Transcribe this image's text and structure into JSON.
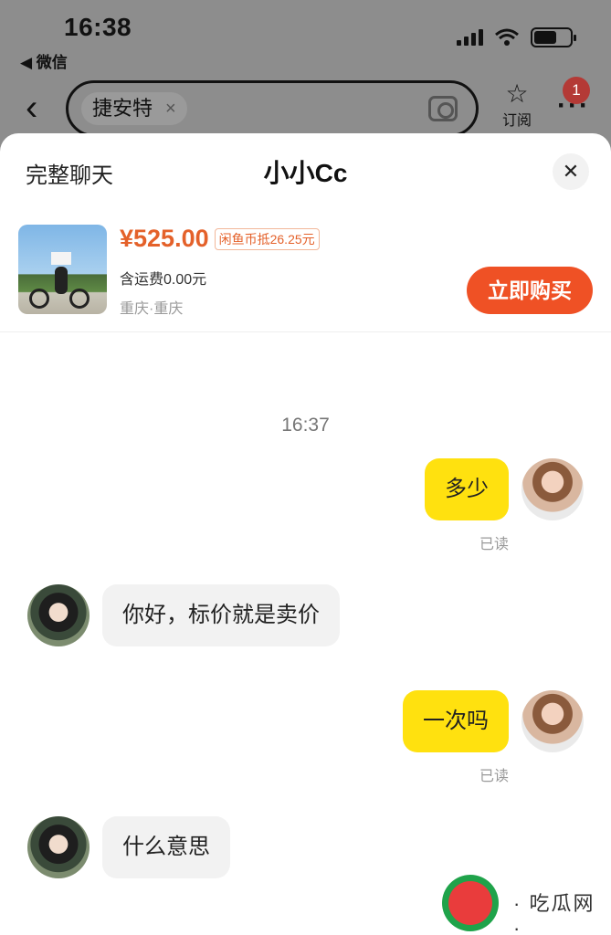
{
  "status_bar": {
    "time": "16:38",
    "back_app": "◀ 微信"
  },
  "background_nav": {
    "search_tag": "捷安特",
    "search_tag_clear": "×",
    "subscribe_label": "订阅",
    "notification_count": "1",
    "more_icon": "···"
  },
  "chat_sheet": {
    "left_link": "完整聊天",
    "title": "小小Cc",
    "close_icon": "✕"
  },
  "product": {
    "price": "¥525.00",
    "coin_offset": "闲鱼币抵26.25元",
    "shipping": "含运费0.00元",
    "location": "重庆·重庆",
    "buy_button": "立即购买"
  },
  "messages": {
    "timestamp": "16:37",
    "items": [
      {
        "from": "me",
        "text": "多少",
        "status": "已读"
      },
      {
        "from": "them",
        "text": "你好，标价就是卖价"
      },
      {
        "from": "me",
        "text": "一次吗",
        "status": "已读"
      },
      {
        "from": "them",
        "text": "什么意思"
      }
    ]
  },
  "watermark": {
    "text": "· 吃瓜网 ·"
  },
  "colors": {
    "accent_orange": "#ef5125",
    "price_orange": "#e4612a",
    "my_bubble": "#ffe10f",
    "their_bubble": "#f2f2f2",
    "badge_red": "#b43a36"
  }
}
